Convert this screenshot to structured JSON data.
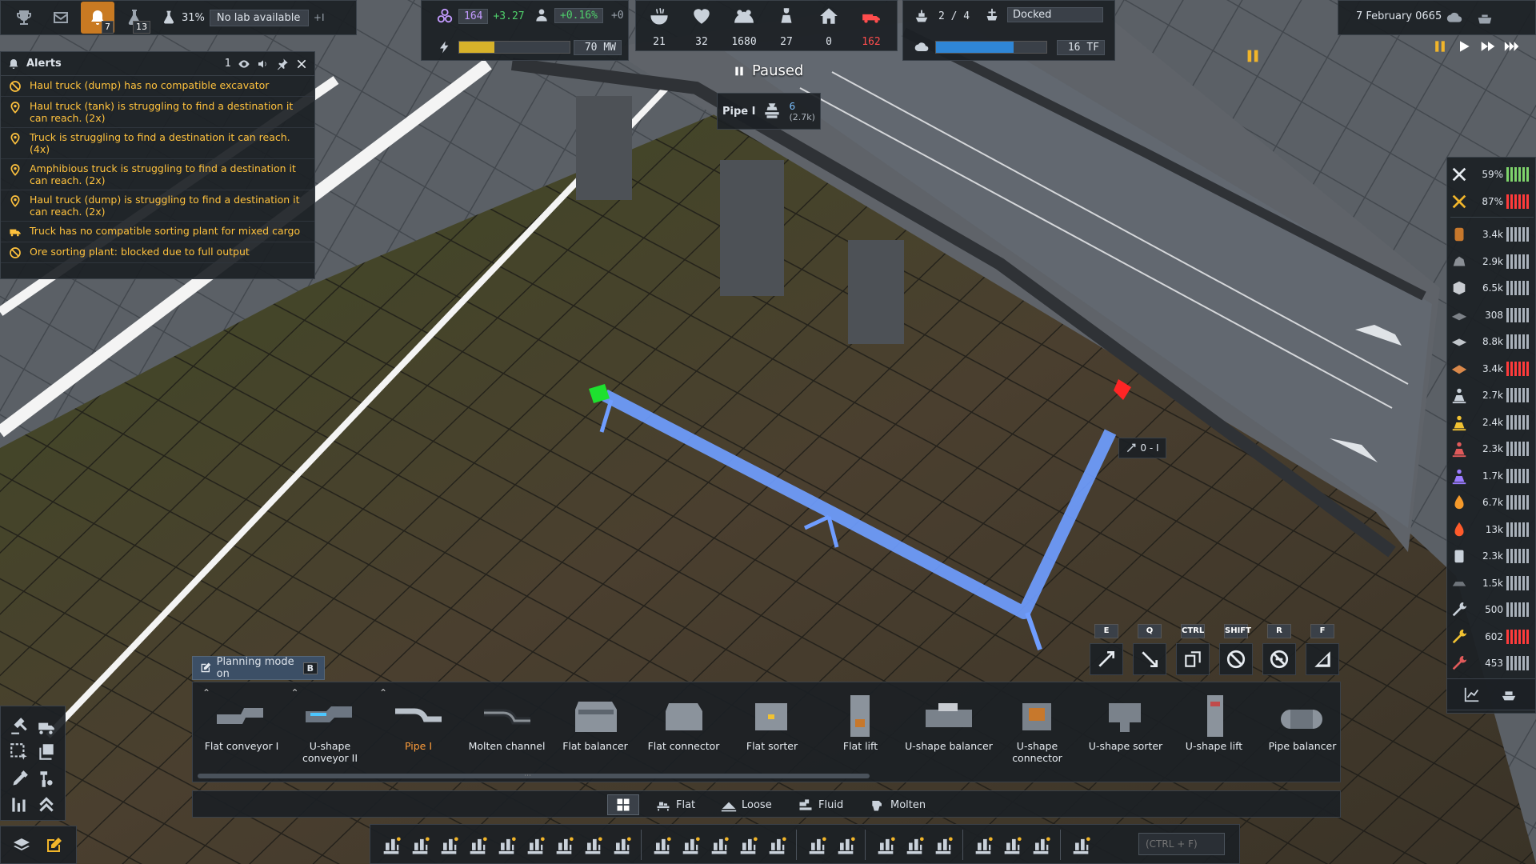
{
  "top_left": {
    "alerts_count": "7",
    "research_count": "13",
    "lab_percent": "31%",
    "lab_status": "No lab available",
    "lab_plus": "+I"
  },
  "stats_a": {
    "unity": "164",
    "unity_delta": "+3.27",
    "pop_delta": "+0.16%",
    "pop_plus": "+0",
    "power": "70 MW",
    "power_fraction": 0.32
  },
  "stats_b": [
    {
      "icon": "food-icon",
      "value": "21"
    },
    {
      "icon": "health-icon",
      "value": "32"
    },
    {
      "icon": "population-icon",
      "value": "1680"
    },
    {
      "icon": "workers-icon",
      "value": "27"
    },
    {
      "icon": "housing-icon",
      "value": "0"
    },
    {
      "icon": "vehicles-icon",
      "value": "162",
      "color": "#ff4d4d"
    }
  ],
  "stats_c": {
    "ships": "2 / 4",
    "ship_status": "Docked",
    "compute": "16 TF",
    "compute_fraction": 0.7
  },
  "top_right": {
    "date": "7 February 0665"
  },
  "alerts": {
    "title": "Alerts",
    "count": "1",
    "items": [
      {
        "icon": "blocked-icon",
        "text": "Haul truck (dump) has no compatible excavator"
      },
      {
        "icon": "pin-icon",
        "text": "Haul truck (tank) is struggling to find a destination it can reach. (2x)"
      },
      {
        "icon": "pin-icon",
        "text": "Truck is struggling to find a destination it can reach. (4x)"
      },
      {
        "icon": "pin-icon",
        "text": "Amphibious truck is struggling to find a destination it can reach. (2x)"
      },
      {
        "icon": "pin-icon",
        "text": "Haul truck (dump) is struggling to find a destination it can reach. (2x)"
      },
      {
        "icon": "truck-icon",
        "text": "Truck has no compatible sorting plant for mixed cargo"
      },
      {
        "icon": "blocked-icon",
        "text": "Ore sorting plant: blocked due to full output"
      }
    ]
  },
  "status": {
    "paused": "Paused"
  },
  "pipe_tooltip": {
    "name": "Pipe I",
    "count": "6",
    "sub": "(2.7k)"
  },
  "segment_tooltip": "0 - I",
  "resources": [
    {
      "icon": "tools-icon",
      "value": "59%",
      "bar": "green"
    },
    {
      "icon": "maintenance-icon",
      "value": "87%",
      "bar": "red"
    },
    {
      "icon": "barrel-icon",
      "value": "3.4k"
    },
    {
      "icon": "rock-icon",
      "value": "2.9k"
    },
    {
      "icon": "crate-icon",
      "value": "6.5k"
    },
    {
      "icon": "plate-icon",
      "value": "308"
    },
    {
      "icon": "sheet-icon",
      "value": "8.8k"
    },
    {
      "icon": "wood-icon",
      "value": "3.4k",
      "bar": "red"
    },
    {
      "icon": "worker-gray-icon",
      "value": "2.7k"
    },
    {
      "icon": "worker-yellow-icon",
      "value": "2.4k"
    },
    {
      "icon": "worker-red-icon",
      "value": "2.3k"
    },
    {
      "icon": "worker-purple-icon",
      "value": "1.7k"
    },
    {
      "icon": "fuel-icon",
      "value": "6.7k"
    },
    {
      "icon": "fire-icon",
      "value": "13k"
    },
    {
      "icon": "canister-icon",
      "value": "2.3k"
    },
    {
      "icon": "ingot-icon",
      "value": "1.5k"
    },
    {
      "icon": "wrench-gray-icon",
      "value": "500"
    },
    {
      "icon": "wrench-yellow-icon",
      "value": "602",
      "bar": "red"
    },
    {
      "icon": "wrench-red-icon",
      "value": "453"
    }
  ],
  "tool_keys": [
    {
      "key": "E",
      "icon": "raise-icon"
    },
    {
      "key": "Q",
      "icon": "lower-icon"
    },
    {
      "key": "CTRL",
      "icon": "copy-icon"
    },
    {
      "key": "SHIFT",
      "icon": "cancel-icon"
    },
    {
      "key": "R",
      "icon": "rotate-cancel-icon"
    },
    {
      "key": "F",
      "icon": "flip-icon"
    }
  ],
  "planning": {
    "label": "Planning mode on",
    "key": "B"
  },
  "build_items": [
    {
      "label": "Flat conveyor I",
      "caret": true
    },
    {
      "label": "U-shape conveyor II",
      "caret": true
    },
    {
      "label": "Pipe I",
      "caret": true,
      "active": true
    },
    {
      "label": "Molten channel"
    },
    {
      "label": "Flat balancer"
    },
    {
      "label": "Flat connector"
    },
    {
      "label": "Flat sorter"
    },
    {
      "label": "Flat lift"
    },
    {
      "label": "U-shape balancer"
    },
    {
      "label": "U-shape connector"
    },
    {
      "label": "U-shape sorter"
    },
    {
      "label": "U-shape lift"
    },
    {
      "label": "Pipe balancer"
    }
  ],
  "categories": {
    "flat": "Flat",
    "loose": "Loose",
    "fluid": "Fluid",
    "molten": "Molten"
  },
  "search": {
    "placeholder": "(CTRL + F)"
  },
  "colors": {
    "accent": "#c97a22",
    "pipe": "#6f9dff",
    "alert": "#ffc23d",
    "active_tool": "#ff9d3a"
  }
}
